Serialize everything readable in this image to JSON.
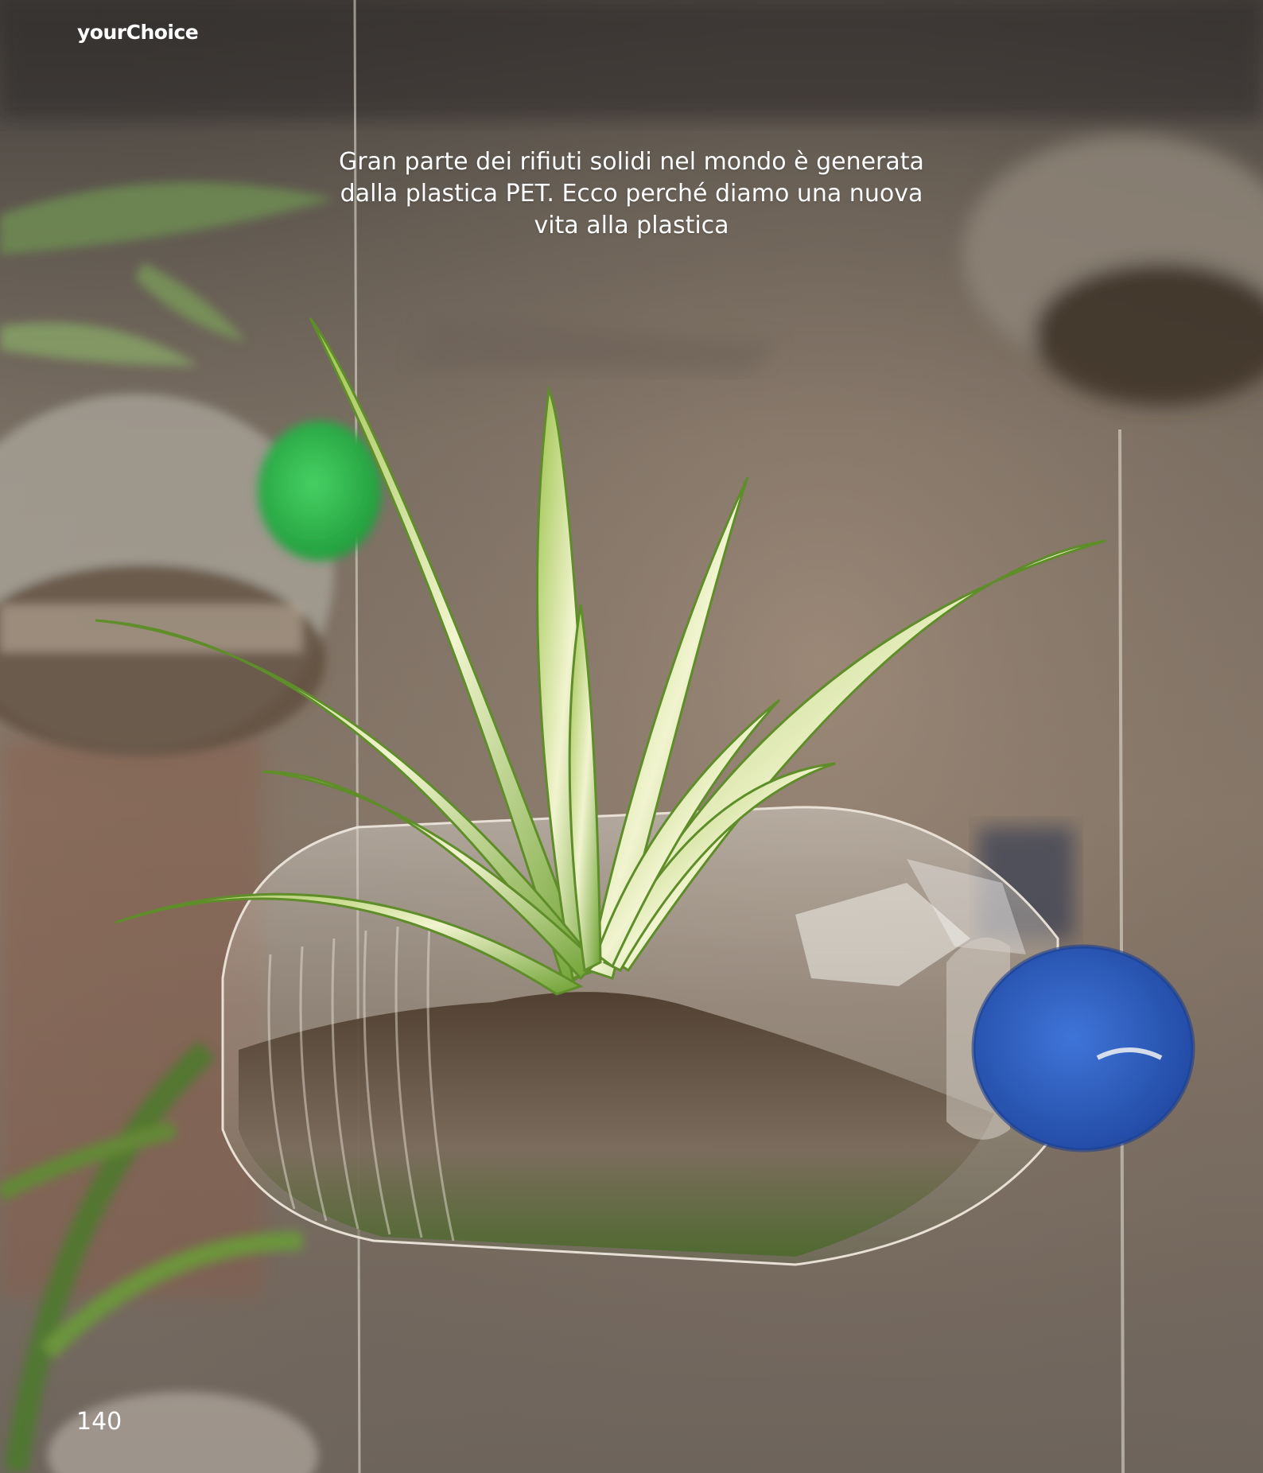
{
  "header": {
    "brand": "yourChoice"
  },
  "main": {
    "headline": "Gran parte dei rifiuti solidi nel mondo è generata dalla plastica PET. Ecco perché diamo una nuova vita alla plastica"
  },
  "footer": {
    "page_number": "140"
  },
  "photo": {
    "subject": "spider plant in recycled plastic bottle planter",
    "colors": {
      "bottle_cap_right": "#2e5fc0",
      "bottle_cap_left": "#2fb54a",
      "leaf_green": "#7fae3c",
      "leaf_cream": "#eef2c8",
      "soil": "#4a3a2a"
    }
  }
}
